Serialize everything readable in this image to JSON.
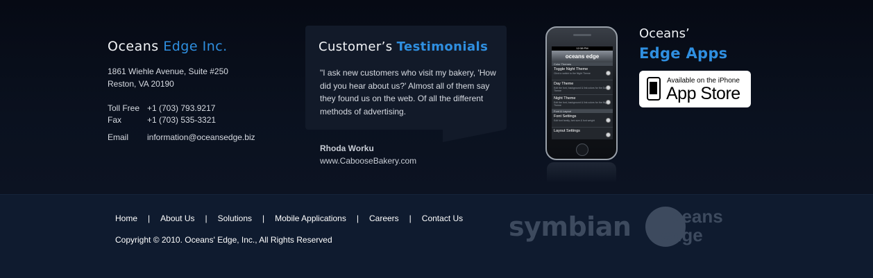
{
  "company": {
    "title_a": "Oceans",
    "title_b": "Edge Inc.",
    "address_line1": "1861 Wiehle Avenue, Suite #250",
    "address_line2": "Reston, VA 20190",
    "tollfree_label": "Toll Free",
    "tollfree_value": "+1  (703) 793.9217",
    "fax_label": "Fax",
    "fax_value": "+1 (703) 535-3321",
    "email_label": "Email",
    "email_value": "information@oceansedge.biz"
  },
  "testimonial": {
    "title_a": "Customer’s",
    "title_b": "Testimonials",
    "quote": "\"I ask new customers who visit my bakery, 'How did you hear about us?' Almost all of them say they found us on the web. Of all the different methods of advertising.",
    "author_name": "Rhoda Worku",
    "author_site": "www.CabooseBakery.com"
  },
  "phone": {
    "status": "12:38 PM",
    "app_logo": "oceans edge",
    "section1": "Color Themes",
    "items": [
      {
        "title": "Toggle Night Theme",
        "desc": "Click to switch to the Night Theme"
      },
      {
        "title": "Day Theme",
        "desc": "Edit the font, background & link colors for the Day Theme"
      },
      {
        "title": "Night Theme",
        "desc": "Edit the font, background & link colors for the Night Theme"
      }
    ],
    "section2": "Font & Layout",
    "items2": [
      {
        "title": "Font Settings",
        "desc": "Edit font family, font size & font weight"
      },
      {
        "title": "Layout Settings",
        "desc": ""
      }
    ]
  },
  "apps": {
    "line1": "Oceans’",
    "line2": "Edge Apps",
    "badge_small": "Available on the iPhone",
    "badge_big": "App Store"
  },
  "footer": {
    "nav": [
      "Home",
      "About Us",
      "Solutions",
      "Mobile Applications",
      "Careers",
      "Contact Us"
    ],
    "separator": "|",
    "copyright": "Copyright © 2010. Oceans' Edge, Inc., All Rights Reserved",
    "symbian": "symbian",
    "logo_line1": "ceans",
    "logo_line2": "edge"
  },
  "colors": {
    "accent": "#2f8fe0",
    "top_bg": "#0a111f",
    "footer_bg": "#0f1b2f"
  }
}
